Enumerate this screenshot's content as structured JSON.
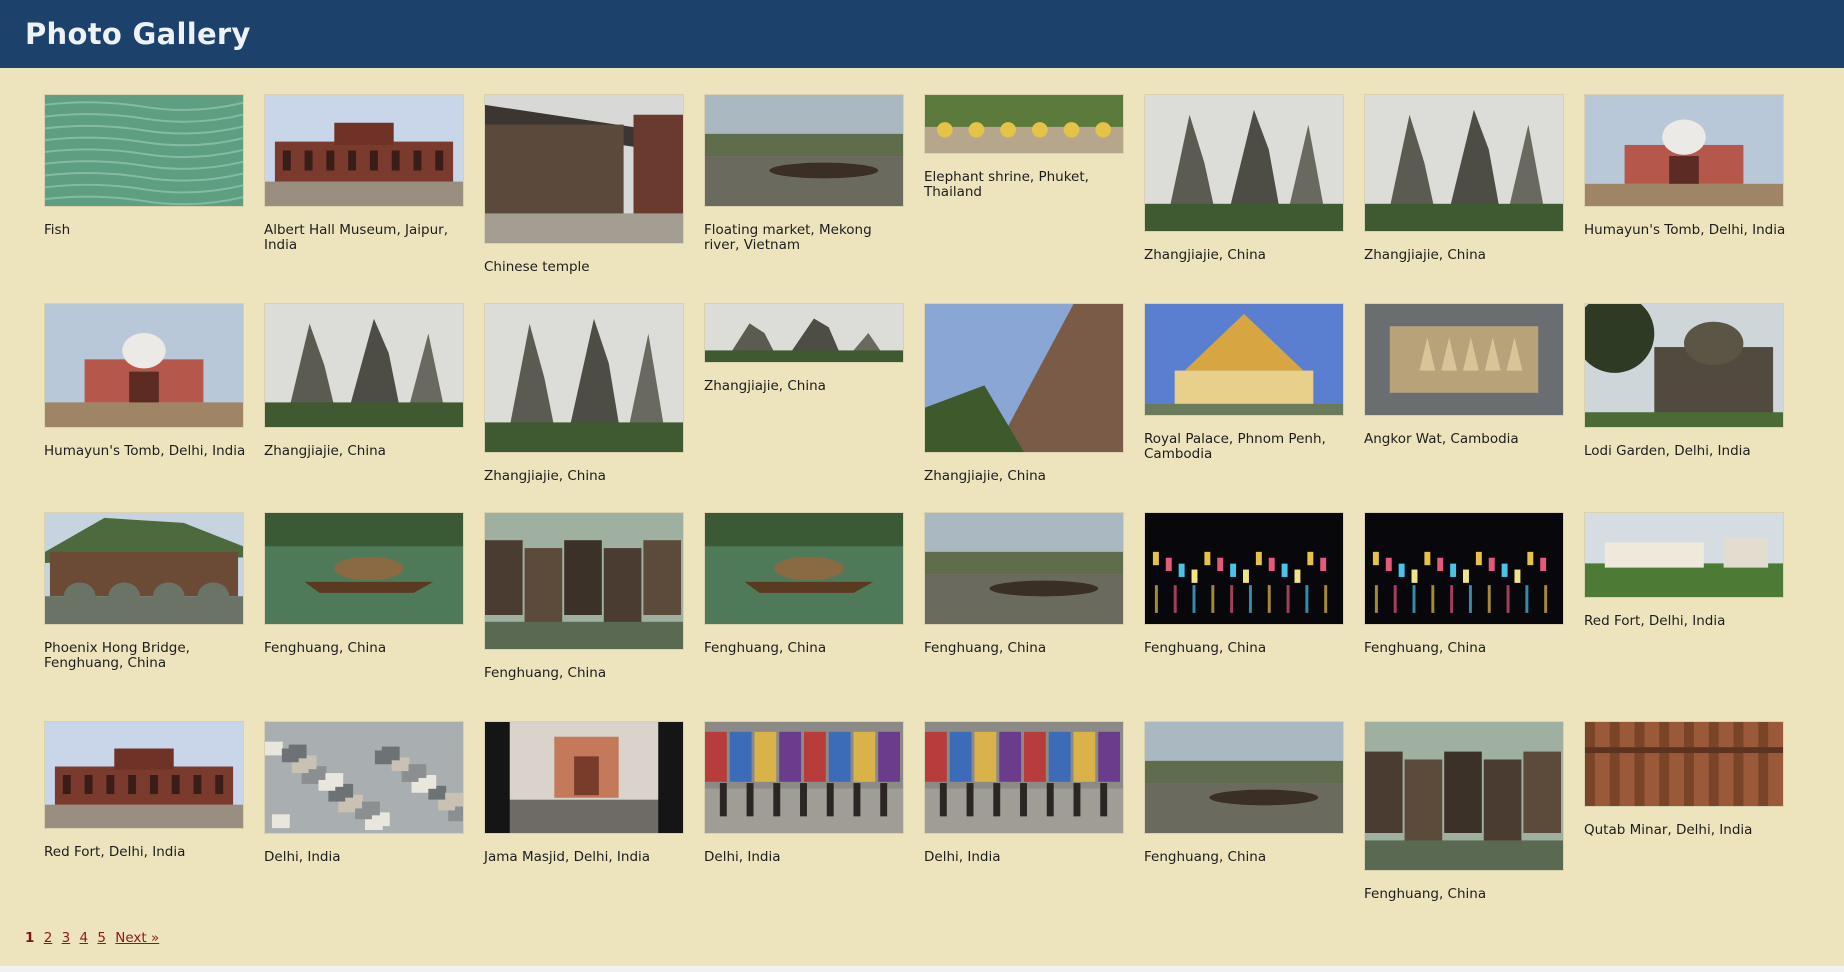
{
  "header": {
    "title": "Photo Gallery"
  },
  "photos": [
    {
      "caption": "Fish",
      "scene": "water"
    },
    {
      "caption": "Albert Hall Museum, Jaipur, India",
      "scene": "palace"
    },
    {
      "caption": "Chinese temple",
      "scene": "temple"
    },
    {
      "caption": "Floating market, Mekong river, Vietnam",
      "scene": "river"
    },
    {
      "caption": "Elephant shrine, Phuket, Thailand",
      "scene": "shrine"
    },
    {
      "caption": "Zhangjiajie, China",
      "scene": "peaks"
    },
    {
      "caption": "Zhangjiajie, China",
      "scene": "peaks"
    },
    {
      "caption": "Humayun's Tomb, Delhi, India",
      "scene": "tomb"
    },
    {
      "caption": "Humayun's Tomb, Delhi, India",
      "scene": "tomb"
    },
    {
      "caption": "Zhangjiajie, China",
      "scene": "peaks"
    },
    {
      "caption": "Zhangjiajie, China",
      "scene": "peaks"
    },
    {
      "caption": "Zhangjiajie, China",
      "scene": "peaks"
    },
    {
      "caption": "Zhangjiajie, China",
      "scene": "cliff"
    },
    {
      "caption": "Royal Palace, Phnom Penh, Cambodia",
      "scene": "palace-gold"
    },
    {
      "caption": "Angkor Wat, Cambodia",
      "scene": "model"
    },
    {
      "caption": "Lodi Garden, Delhi, India",
      "scene": "tomb-dark"
    },
    {
      "caption": "Phoenix Hong Bridge, Fenghuang, China",
      "scene": "bridge"
    },
    {
      "caption": "Fenghuang, China",
      "scene": "boat"
    },
    {
      "caption": "Fenghuang, China",
      "scene": "houses"
    },
    {
      "caption": "Fenghuang, China",
      "scene": "boat"
    },
    {
      "caption": "Fenghuang, China",
      "scene": "river"
    },
    {
      "caption": "Fenghuang, China",
      "scene": "night"
    },
    {
      "caption": "Fenghuang, China",
      "scene": "night"
    },
    {
      "caption": "Red Fort, Delhi, India",
      "scene": "fort"
    },
    {
      "caption": "Red Fort, Delhi, India",
      "scene": "palace"
    },
    {
      "caption": "Delhi, India",
      "scene": "city"
    },
    {
      "caption": "Jama Masjid, Delhi, India",
      "scene": "mosque"
    },
    {
      "caption": "Delhi, India",
      "scene": "market"
    },
    {
      "caption": "Delhi, India",
      "scene": "market"
    },
    {
      "caption": "Fenghuang, China",
      "scene": "river"
    },
    {
      "caption": "Fenghuang, China",
      "scene": "houses"
    },
    {
      "caption": "Qutab Minar, Delhi, India",
      "scene": "minar"
    }
  ],
  "pagination": {
    "current": "1",
    "pages": [
      "2",
      "3",
      "4",
      "5"
    ],
    "next": "Next »"
  }
}
